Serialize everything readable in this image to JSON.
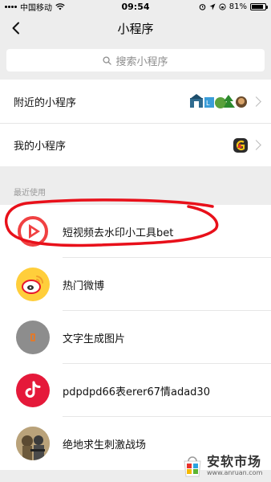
{
  "status_bar": {
    "carrier": "中国移动",
    "time": "09:54",
    "battery": "81%"
  },
  "header": {
    "title": "小程序"
  },
  "search": {
    "placeholder": "搜索小程序"
  },
  "menu": [
    {
      "label": "附近的小程序"
    },
    {
      "label": "我的小程序"
    }
  ],
  "recent": {
    "label": "最近使用",
    "items": [
      {
        "name": "短视频去水印小工具bet",
        "icon": "video-play-icon"
      },
      {
        "name": "热门微博",
        "icon": "weibo-icon"
      },
      {
        "name": "文字生成图片",
        "icon": "text-image-icon"
      },
      {
        "name": "pdpdpd66表erer67情adad30",
        "icon": "tiktok-icon"
      },
      {
        "name": "绝地求生刺激战场",
        "icon": "pubg-icon"
      }
    ]
  },
  "watermark": {
    "cn": "安软市场",
    "en": "www.anruan.com"
  },
  "colors": {
    "background": "#ededed",
    "annotation": "#e8101a",
    "icon_red": "#f04142"
  }
}
